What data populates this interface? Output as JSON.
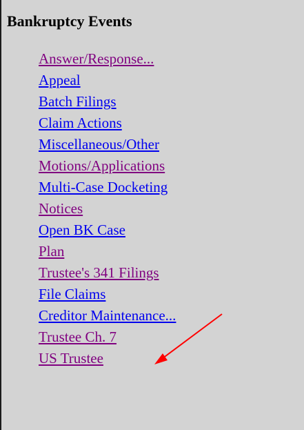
{
  "panel": {
    "title": "Bankruptcy Events"
  },
  "menu": {
    "items": [
      {
        "label": "Answer/Response...",
        "state": "visited"
      },
      {
        "label": "Appeal",
        "state": "unvisited"
      },
      {
        "label": "Batch Filings",
        "state": "unvisited"
      },
      {
        "label": "Claim Actions",
        "state": "unvisited"
      },
      {
        "label": "Miscellaneous/Other",
        "state": "unvisited"
      },
      {
        "label": "Motions/Applications",
        "state": "visited"
      },
      {
        "label": "Multi-Case Docketing",
        "state": "unvisited"
      },
      {
        "label": "Notices",
        "state": "visited"
      },
      {
        "label": "Open BK Case",
        "state": "unvisited"
      },
      {
        "label": "Plan",
        "state": "visited"
      },
      {
        "label": "Trustee's 341 Filings",
        "state": "visited"
      },
      {
        "label": "File Claims",
        "state": "unvisited"
      },
      {
        "label": "Creditor Maintenance...",
        "state": "unvisited"
      },
      {
        "label": "Trustee Ch. 7",
        "state": "visited"
      },
      {
        "label": "US Trustee",
        "state": "visited"
      }
    ]
  },
  "colors": {
    "background": "#d3d3d3",
    "link_unvisited": "#0000ee",
    "link_visited": "#800080",
    "annotation_arrow": "#ff0000"
  },
  "annotation": {
    "icon": "red-arrow-icon",
    "points_to": "Trustee Ch. 7"
  }
}
